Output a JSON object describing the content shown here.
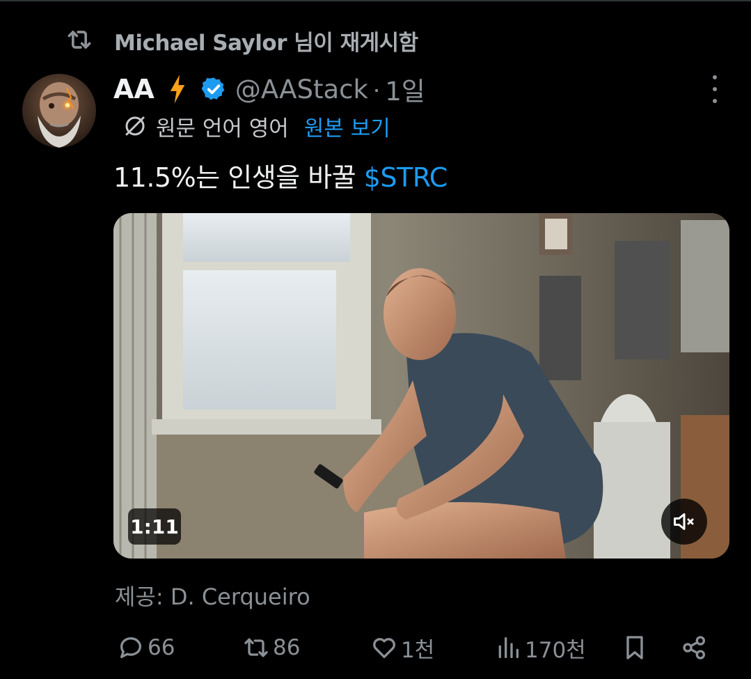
{
  "repost": {
    "text": "Michael Saylor 님이 재게시함"
  },
  "author": {
    "name": "AA",
    "handle": "@AAStack",
    "separator": "·",
    "time": "1일"
  },
  "translation": {
    "label": "원문 언어 영어",
    "action": "원본 보기"
  },
  "tweet": {
    "text": "11.5%는 인생을 바꿀 ",
    "cashtag": "$STRC"
  },
  "media": {
    "duration": "1:11",
    "credit": "제공: D. Cerqueiro"
  },
  "actions": {
    "replies": "66",
    "reposts": "86",
    "likes": "1천",
    "views": "170천"
  },
  "colors": {
    "accent": "#1d9bf0",
    "background": "#000000",
    "muted": "#8b9196"
  }
}
